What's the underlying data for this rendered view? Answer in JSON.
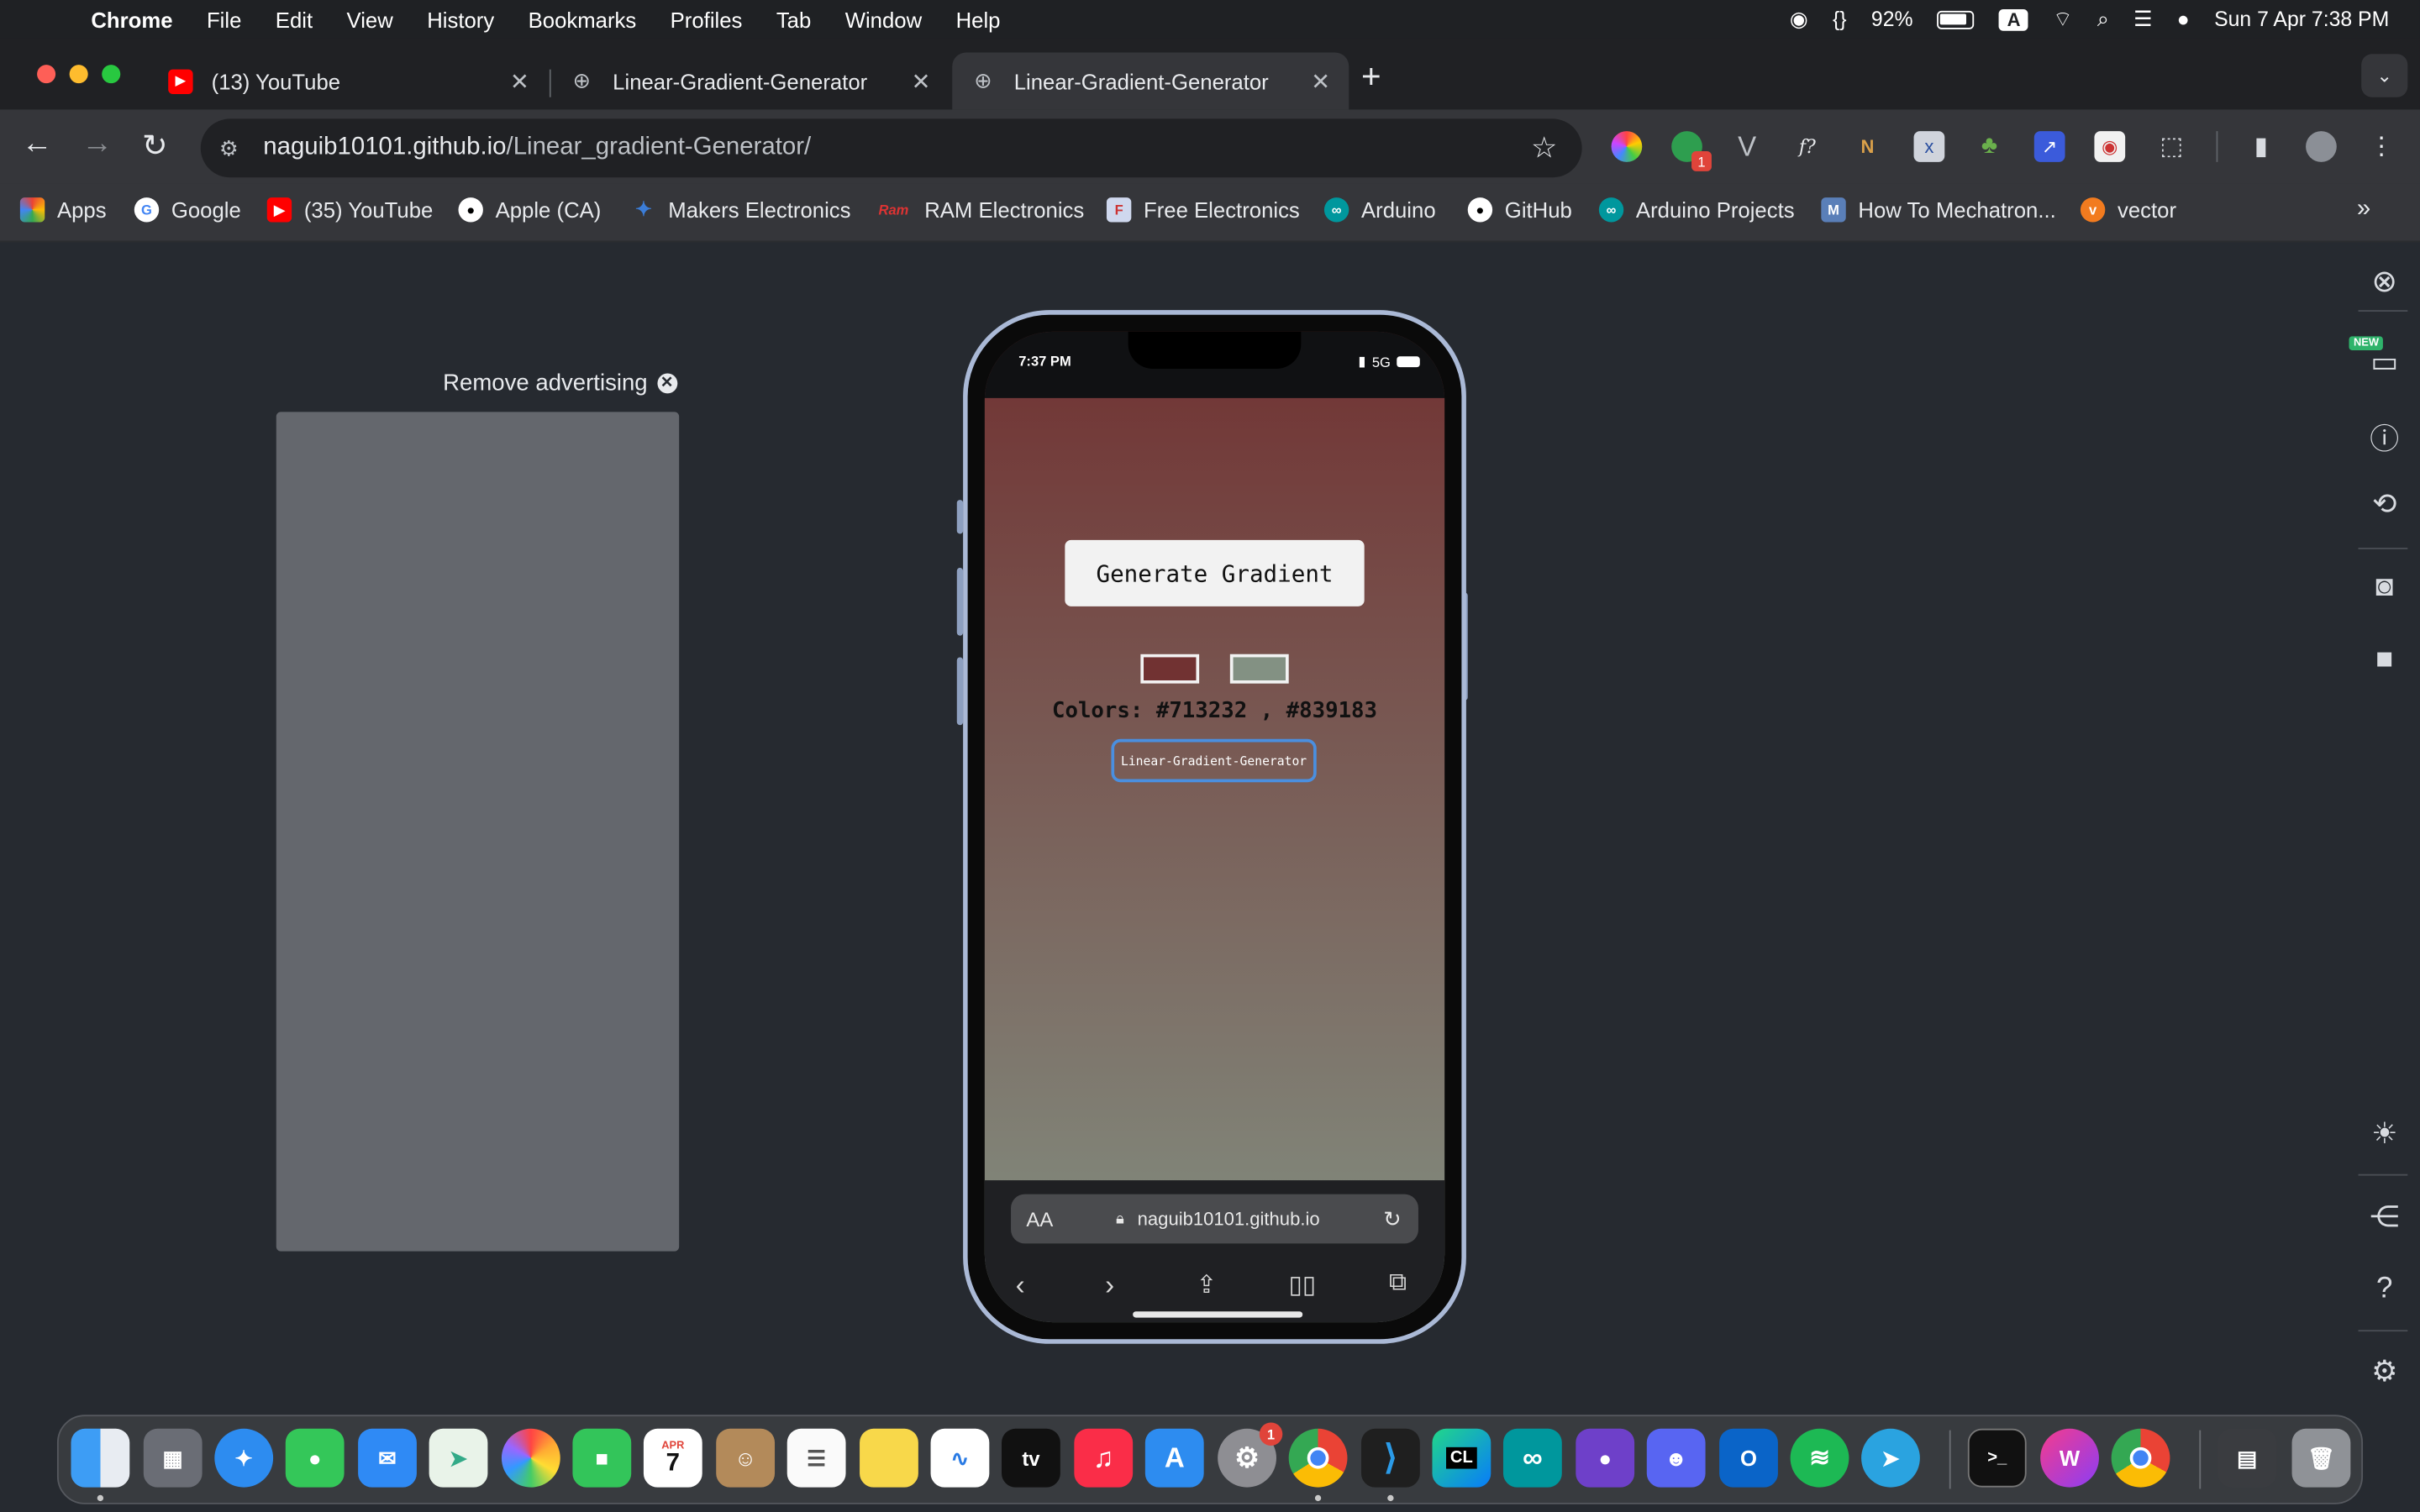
{
  "menubar": {
    "app": "Chrome",
    "items": [
      "File",
      "Edit",
      "View",
      "History",
      "Bookmarks",
      "Profiles",
      "Tab",
      "Window",
      "Help"
    ],
    "status": {
      "braces": "{}",
      "battery": "92%",
      "input": "A",
      "datetime": "Sun 7 Apr  7:38 PM"
    }
  },
  "tabs": [
    {
      "label": "(13) YouTube",
      "favicon": "youtube-icon",
      "close": "✕"
    },
    {
      "label": "Linear-Gradient-Generator",
      "favicon": "globe-icon",
      "close": "✕"
    },
    {
      "label": "Linear-Gradient-Generator",
      "favicon": "globe-icon",
      "close": "✕",
      "active": true
    }
  ],
  "newtab": "+",
  "toolbar": {
    "url_host": "naguib10101.github.io",
    "url_path": "/Linear_gradient-Generator/",
    "ext_badge": "1"
  },
  "bookmarks": [
    {
      "label": "Apps",
      "icon": "apps-grid-icon"
    },
    {
      "label": "Google",
      "icon": "google-icon"
    },
    {
      "label": "(35) YouTube",
      "icon": "youtube-icon"
    },
    {
      "label": "Apple (CA)",
      "icon": "apple-icon"
    },
    {
      "label": "Makers Electronics",
      "icon": "makers-icon"
    },
    {
      "label": "RAM Electronics",
      "icon": "ram-icon"
    },
    {
      "label": "Free Electronics",
      "icon": "free-electronics-icon"
    },
    {
      "label": "Arduino",
      "icon": "arduino-icon"
    },
    {
      "label": "GitHub",
      "icon": "github-icon"
    },
    {
      "label": "Arduino Projects",
      "icon": "arduino-icon"
    },
    {
      "label": "How To Mechatron...",
      "icon": "mechatronics-icon"
    },
    {
      "label": "vector",
      "icon": "vector-icon"
    }
  ],
  "ad": {
    "remove_label": "Remove advertising"
  },
  "phone": {
    "time": "7:37 PM",
    "network": "5G",
    "generate_label": "Generate Gradient",
    "color1": "#713232",
    "color2": "#839183",
    "colors_text": "Colors: #713232 , #839183",
    "repo_label": "Linear-Gradient-Generator",
    "safari_aa": "AA",
    "safari_host": "naguib10101.github.io"
  },
  "right_panel": {
    "new_badge": "NEW"
  },
  "dock": {
    "calendar_month": "APR",
    "calendar_day": "7",
    "settings_badge": "1",
    "tv_label": "tv",
    "clion_label": "CL"
  }
}
